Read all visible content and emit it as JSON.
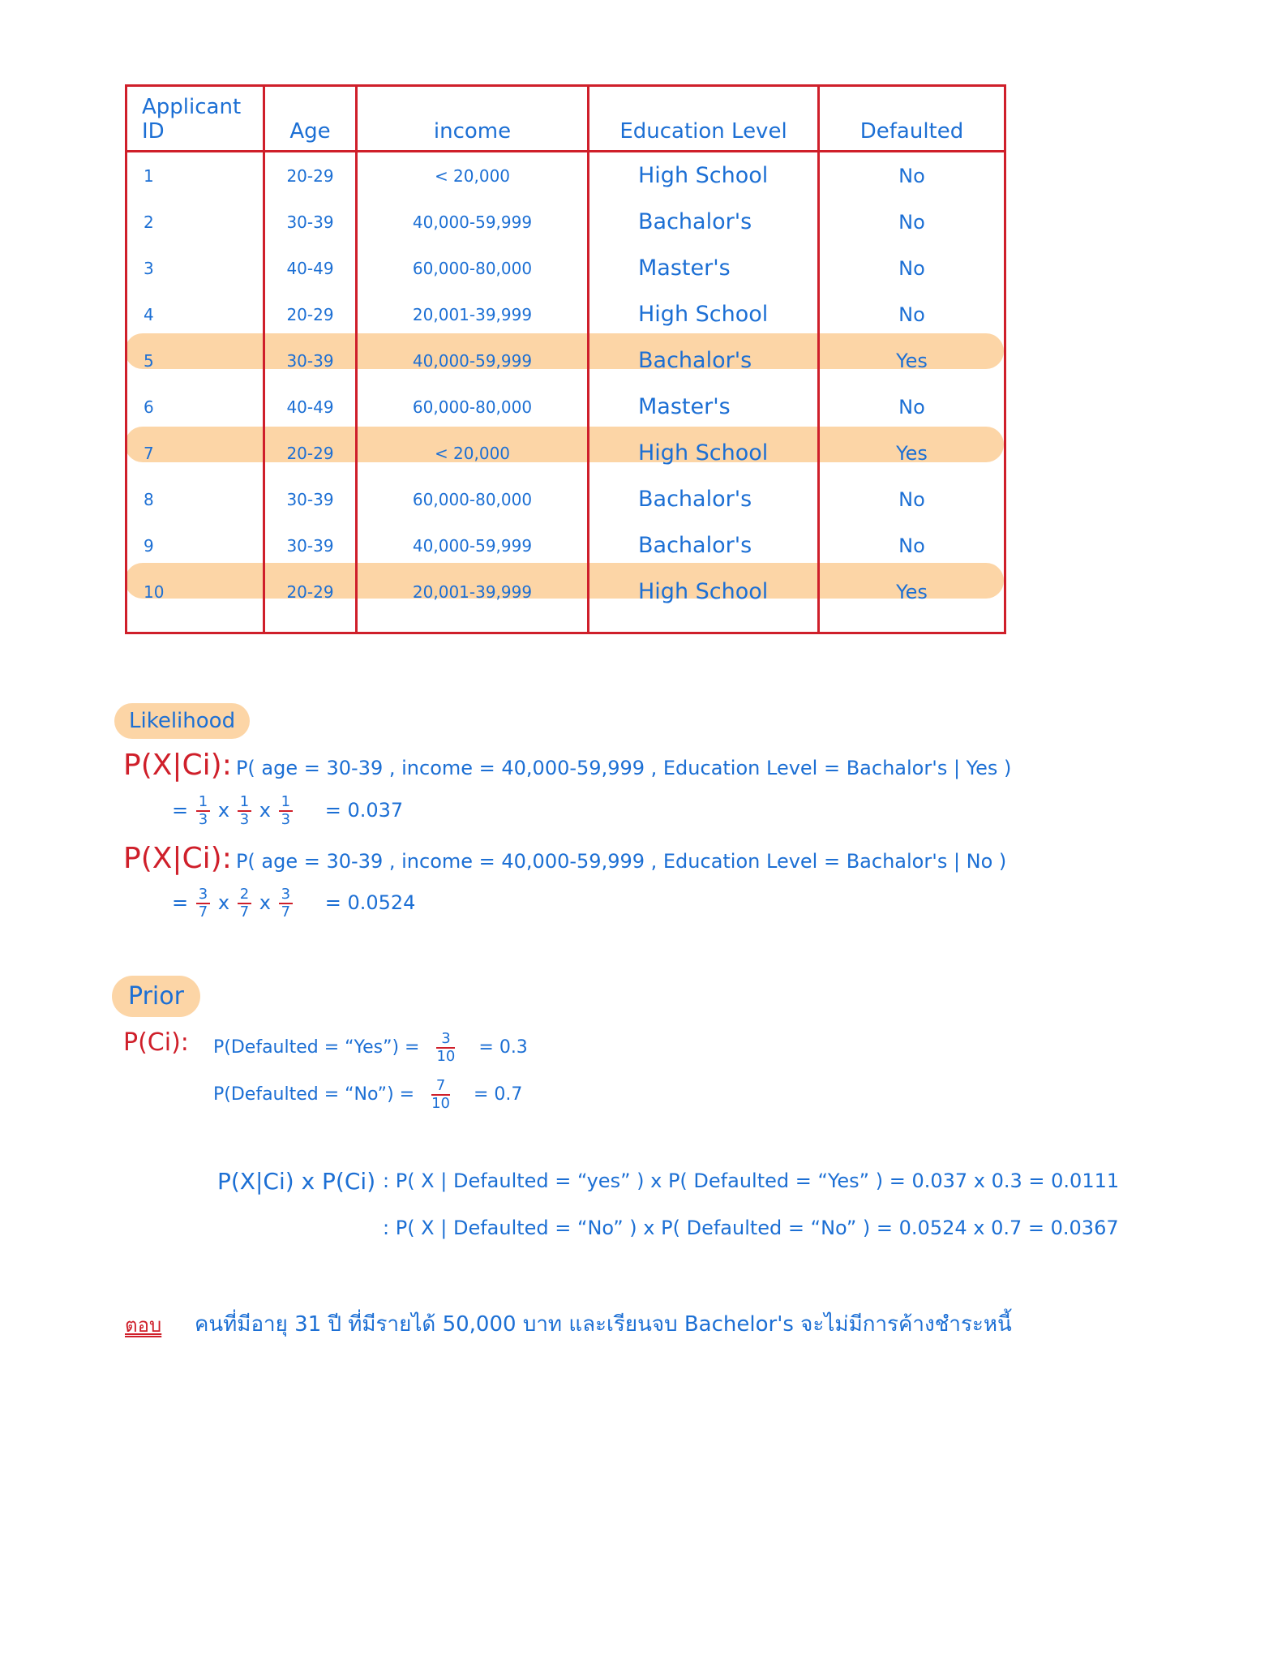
{
  "table": {
    "headers": [
      "Applicant ID",
      "Age",
      "income",
      "Education Level",
      "Defaulted"
    ],
    "rows": [
      [
        "1",
        "20-29",
        "< 20,000",
        "High School",
        "No"
      ],
      [
        "2",
        "30-39",
        "40,000-59,999",
        "Bachalor's",
        "No"
      ],
      [
        "3",
        "40-49",
        "60,000-80,000",
        "Master's",
        "No"
      ],
      [
        "4",
        "20-29",
        "20,001-39,999",
        "High School",
        "No"
      ],
      [
        "5",
        "30-39",
        "40,000-59,999",
        "Bachalor's",
        "Yes"
      ],
      [
        "6",
        "40-49",
        "60,000-80,000",
        "Master's",
        "No"
      ],
      [
        "7",
        "20-29",
        "< 20,000",
        "High School",
        "Yes"
      ],
      [
        "8",
        "30-39",
        "60,000-80,000",
        "Bachalor's",
        "No"
      ],
      [
        "9",
        "30-39",
        "40,000-59,999",
        "Bachalor's",
        "No"
      ],
      [
        "10",
        "20-29",
        "20,001-39,999",
        "High School",
        "Yes"
      ]
    ],
    "highlight_color": "#fcd5a6",
    "border_color": "#cf1f2a"
  },
  "likelihood": {
    "label": "Likelihood",
    "lhs": "P(X|Ci):",
    "expr_yes": "P( age = 30-39 , income = 40,000-59,999 , Education Level = Bachalor's | Yes )",
    "calc_yes": {
      "prefix": "=",
      "fractions": [
        [
          "1",
          "3"
        ],
        [
          "1",
          "3"
        ],
        [
          "1",
          "3"
        ]
      ],
      "result": "= 0.037"
    },
    "expr_no": "P( age = 30-39 , income = 40,000-59,999 , Education Level = Bachalor's | No )",
    "calc_no": {
      "prefix": "=",
      "fractions": [
        [
          "3",
          "7"
        ],
        [
          "2",
          "7"
        ],
        [
          "3",
          "7"
        ]
      ],
      "result": "= 0.0524"
    }
  },
  "prior": {
    "label": "Prior",
    "lhs": "P(Ci):",
    "yes": {
      "text": "P(Defaulted = “Yes”) =",
      "num": "3",
      "den": "10",
      "result": "= 0.3"
    },
    "no": {
      "text": "P(Defaulted = “No”) =",
      "num": "7",
      "den": "10",
      "result": "= 0.7"
    }
  },
  "posterior": {
    "lhs": "P(X|Ci) x P(Ci)",
    "line_yes": ": P( X | Defaulted = “yes” ) x P( Defaulted = “Yes” ) = 0.037 x 0.3 = 0.0111",
    "line_no": ": P( X | Defaulted = “No” ) x P( Defaulted = “No” ) = 0.0524 x 0.7 = 0.0367"
  },
  "answer": {
    "label": "ตอบ",
    "text": "คนที่มีอายุ 31 ปี ที่มีรายได้ 50,000 บาท และเรียนจบ Bachelor's จะไม่มีการค้างชำระหนี้"
  },
  "colors": {
    "ink": "#1c6fd4",
    "accent": "#cf1f2a"
  }
}
